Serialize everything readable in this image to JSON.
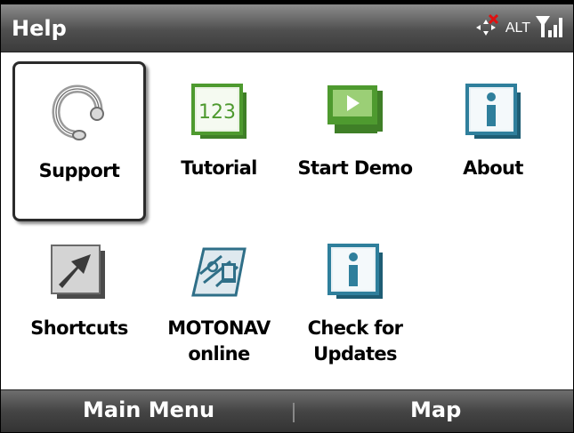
{
  "header": {
    "title": "Help",
    "alt_label": "ALT"
  },
  "tiles": [
    {
      "label": "Support",
      "icon": "headset-icon"
    },
    {
      "label": "Tutorial",
      "icon": "tutorial-123-icon"
    },
    {
      "label": "Start Demo",
      "icon": "demo-play-icon"
    },
    {
      "label": "About",
      "icon": "info-icon"
    },
    {
      "label": "Shortcuts",
      "icon": "shortcut-arrow-icon"
    },
    {
      "label": "MOTONAV online",
      "icon": "motonav-online-icon"
    },
    {
      "label": "Check for Updates",
      "icon": "info-icon"
    }
  ],
  "softkeys": {
    "left": "Main Menu",
    "right": "Map"
  },
  "colors": {
    "bar": "#4f4f4f",
    "icon_green": "#4e9a2f",
    "icon_blue": "#1f6f8b"
  }
}
